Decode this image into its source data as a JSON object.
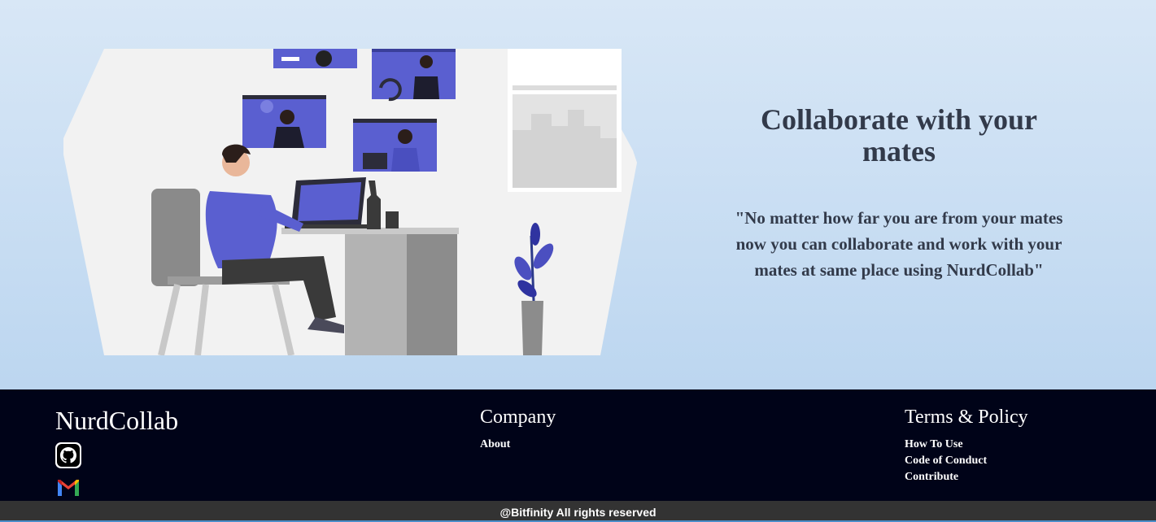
{
  "hero": {
    "title": "Collaborate with your mates",
    "quote": "\"No matter how far you are from your mates now you can collaborate and work with your mates at same place using NurdCollab\""
  },
  "footer": {
    "brand": "NurdCollab",
    "social": [
      {
        "icon": "github-icon"
      },
      {
        "icon": "gmail-icon"
      }
    ],
    "company": {
      "title": "Company",
      "links": [
        "About"
      ]
    },
    "terms": {
      "title": "Terms & Policy",
      "links": [
        "How To Use",
        "Code of Conduct",
        "Contribute"
      ]
    },
    "copyright": "@Bitfinity All rights reserved"
  },
  "colors": {
    "accent": "#5a5fd0",
    "footer_bg": "#000318",
    "hero_text": "#323a4a"
  }
}
